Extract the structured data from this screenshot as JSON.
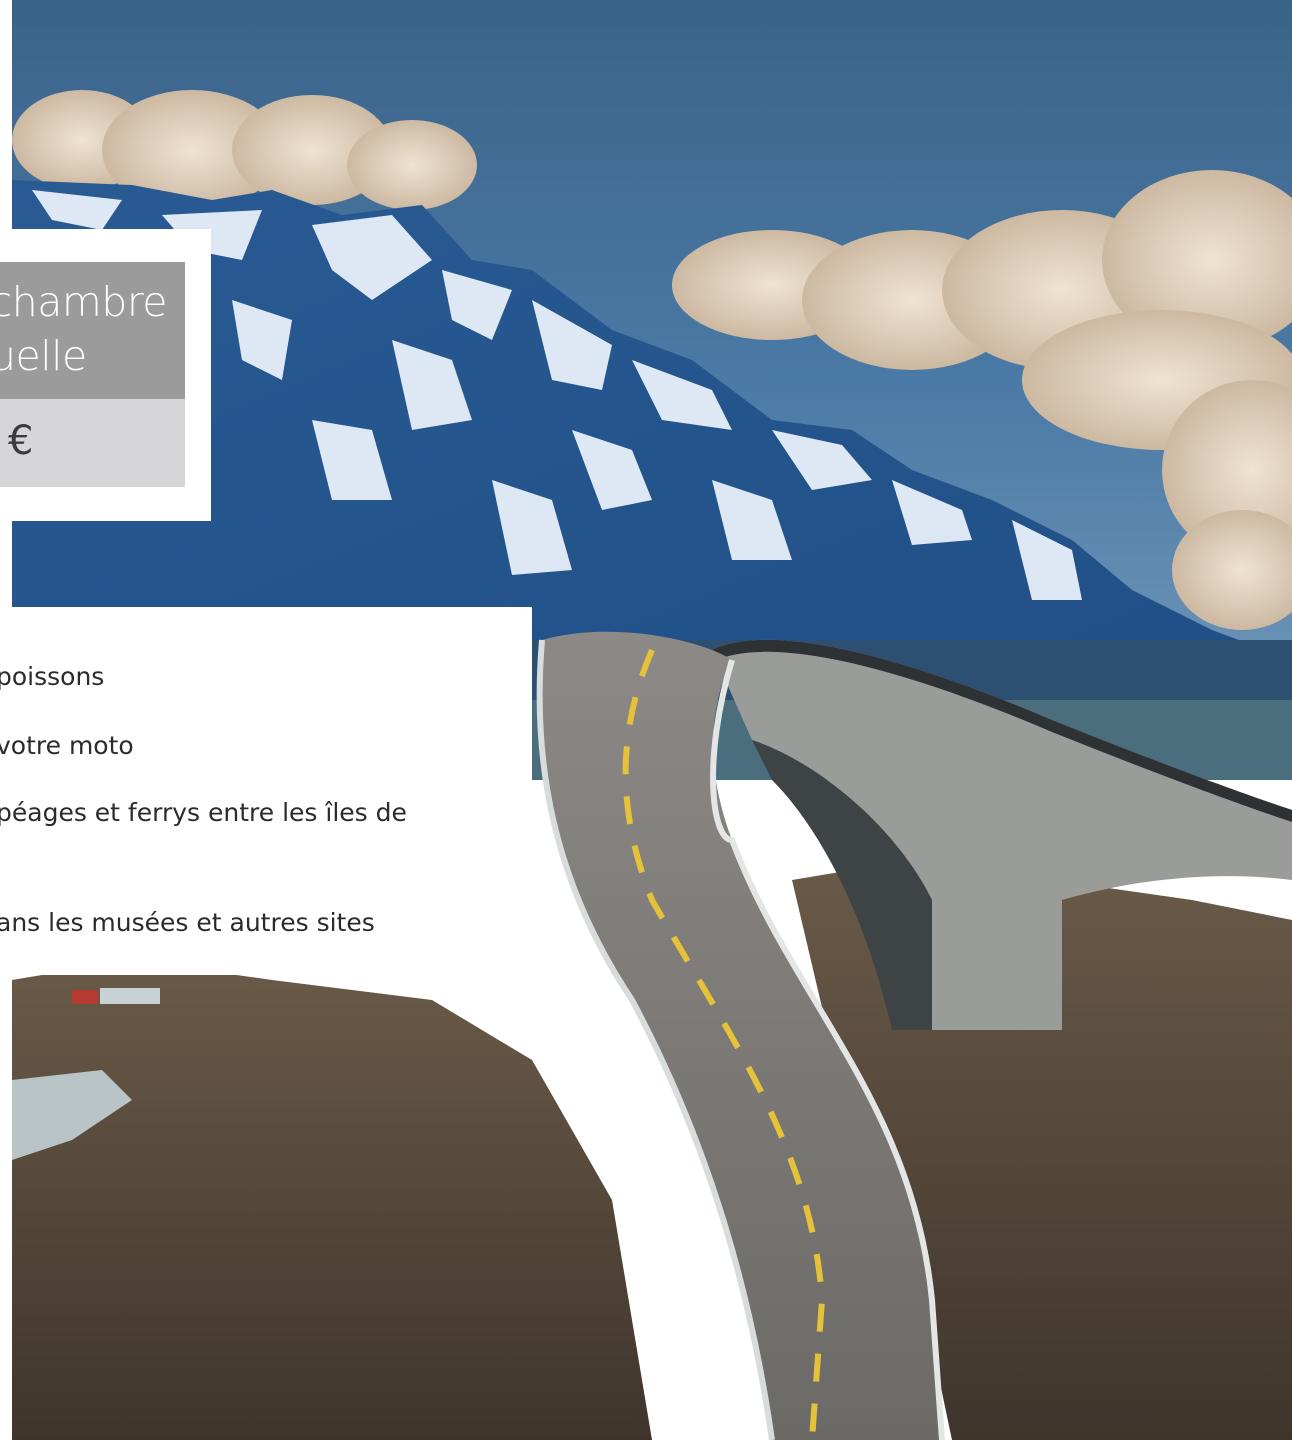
{
  "price_box": {
    "title_line1": "chambre",
    "title_line2": "uelle",
    "price": "€"
  },
  "included_list": {
    "items": [
      "poissons",
      "votre moto",
      "péages et ferrys entre les îles de",
      "ans les musées et autres sites"
    ]
  },
  "photo": {
    "subject": "mountain-road-bridge-photo",
    "colors": {
      "sky": "#3f6a93",
      "cloud": "#d8c6b1",
      "mountain": "#2f5f95",
      "snow": "#eaf2fb",
      "road": "#7c7a78",
      "lane_marking": "#e6c23a",
      "rocks": "#5b4c3c"
    }
  }
}
